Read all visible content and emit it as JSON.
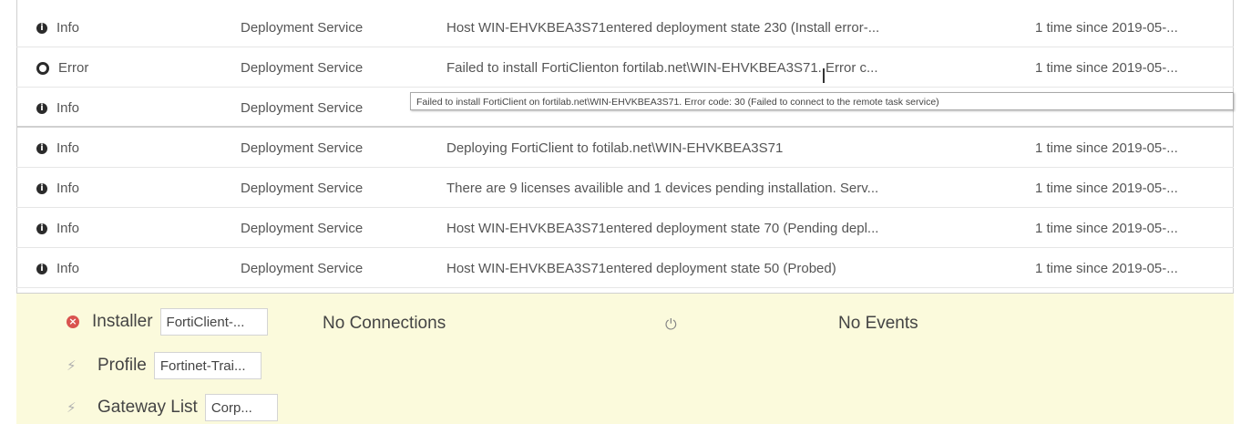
{
  "log_rows": [
    {
      "severity": "Info",
      "severity_icon": "info-icon",
      "source": "Deployment Service",
      "message": "Host WIN-EHVKBEA3S71entered deployment state 230 (Install error-...",
      "count": "1 time since 2019-05-..."
    },
    {
      "severity": "Error",
      "severity_icon": "error-icon",
      "source": "Deployment Service",
      "message": "Failed to install FortiClienton fortilab.net\\WIN-EHVKBEA3S71. Error c...",
      "count": "1 time since 2019-05-..."
    },
    {
      "severity": "Info",
      "severity_icon": "info-icon",
      "source": "Deployment Service",
      "message": "",
      "count": ""
    },
    {
      "severity": "Info",
      "severity_icon": "info-icon",
      "source": "Deployment Service",
      "message": "Deploying FortiClient to fotilab.net\\WIN-EHVKBEA3S71",
      "count": "1 time since 2019-05-..."
    },
    {
      "severity": "Info",
      "severity_icon": "info-icon",
      "source": "Deployment Service",
      "message": "There are 9 licenses availible and 1 devices pending installation. Serv...",
      "count": "1 time since 2019-05-..."
    },
    {
      "severity": "Info",
      "severity_icon": "info-icon",
      "source": "Deployment Service",
      "message": "Host WIN-EHVKBEA3S71entered deployment state 70 (Pending depl...",
      "count": "1 time since 2019-05-..."
    },
    {
      "severity": "Info",
      "severity_icon": "info-icon",
      "source": "Deployment Service",
      "message": "Host WIN-EHVKBEA3S71entered deployment state 50 (Probed)",
      "count": "1 time since 2019-05-..."
    }
  ],
  "tooltip": "Failed to install FortiClient on fortilab.net\\WIN-EHVKBEA3S71. Error code: 30 (Failed to connect to the remote task service)",
  "details": {
    "installer_label": "Installer",
    "installer_value": "FortiClient-...",
    "profile_label": "Profile",
    "profile_value": "Fortinet-Trai...",
    "gateway_label": "Gateway List",
    "gateway_value": "Corp...",
    "connections_status": "No Connections",
    "events_status": "No Events"
  },
  "colors": {
    "panel_bg": "#fbfadc",
    "error_red": "#d9534f"
  }
}
